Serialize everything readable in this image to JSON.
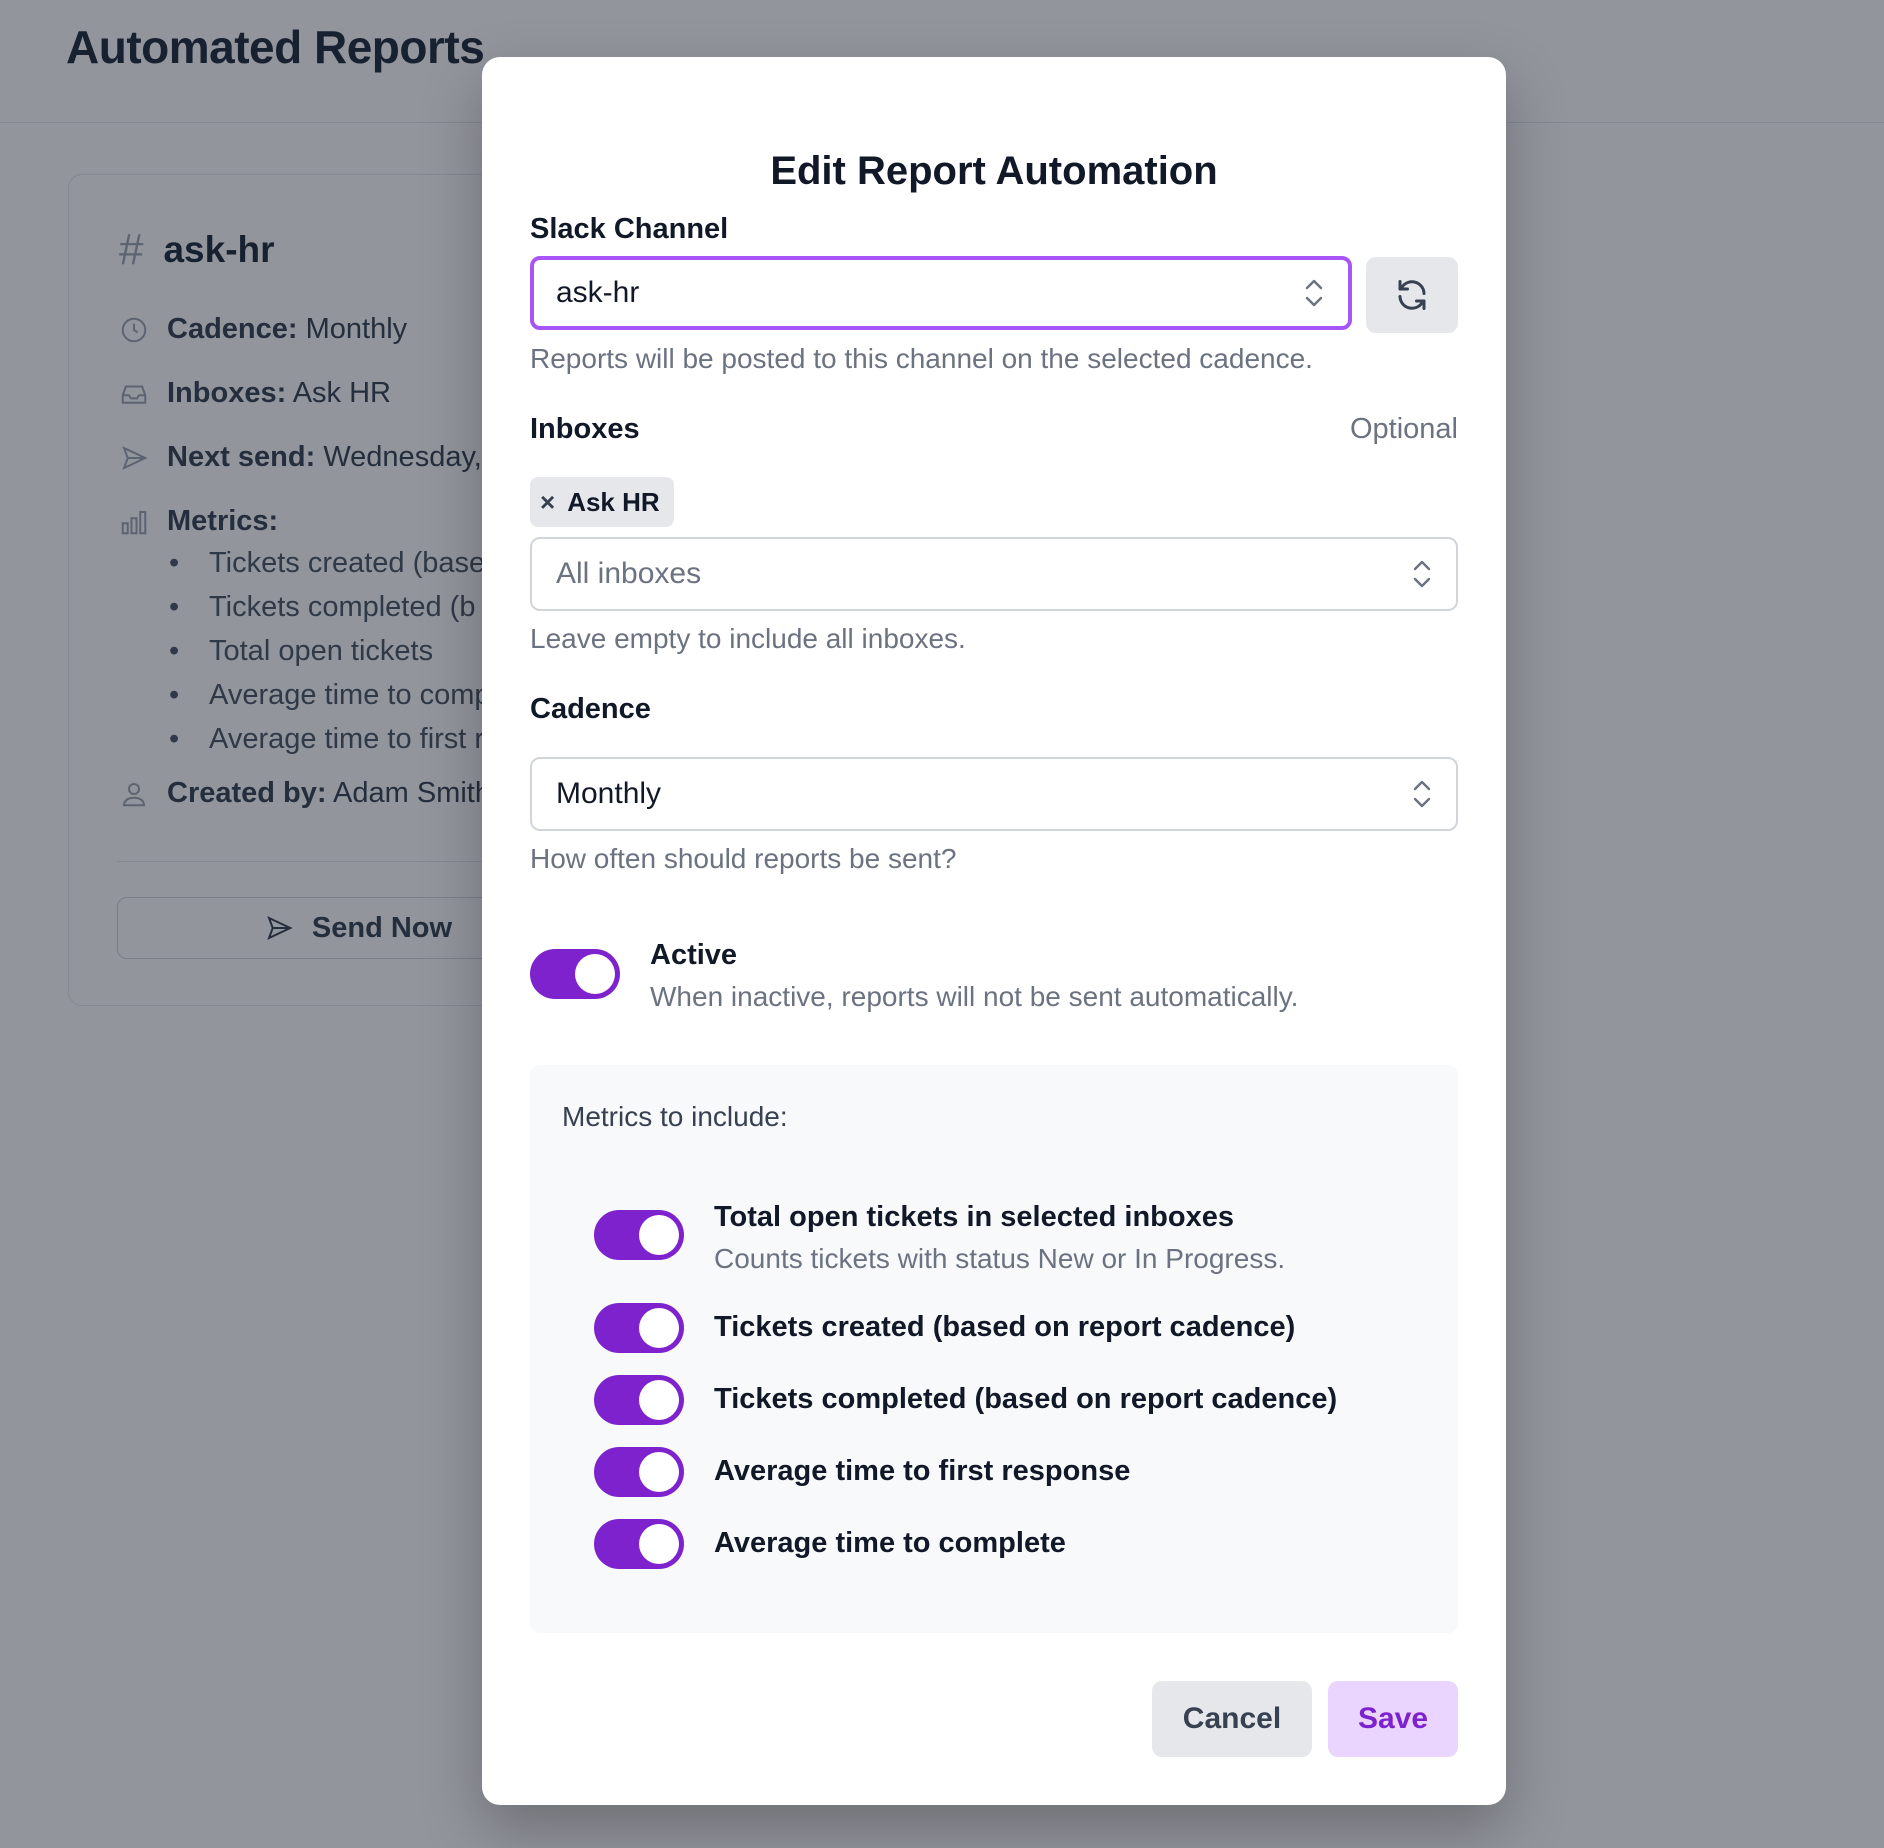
{
  "page": {
    "title": "Automated Reports",
    "card": {
      "channel": "ask-hr",
      "cadence_label": "Cadence:",
      "cadence_value": "Monthly",
      "inboxes_label": "Inboxes:",
      "inboxes_value": "Ask HR",
      "next_send_label": "Next send:",
      "next_send_value": "Wednesday, I",
      "metrics_label": "Metrics:",
      "metrics": [
        "Tickets created (base",
        "Tickets completed (b",
        "Total open tickets",
        "Average time to comp",
        "Average time to first r"
      ],
      "created_by_label": "Created by:",
      "created_by_value": "Adam Smith",
      "send_now_label": "Send Now"
    }
  },
  "modal": {
    "title": "Edit Report Automation",
    "slack_channel": {
      "label": "Slack Channel",
      "value": "ask-hr",
      "help": "Reports will be posted to this channel on the selected cadence."
    },
    "inboxes": {
      "label": "Inboxes",
      "optional": "Optional",
      "chips": [
        "Ask HR"
      ],
      "chip_remove": "×",
      "placeholder": "All inboxes",
      "help": "Leave empty to include all inboxes."
    },
    "cadence": {
      "label": "Cadence",
      "value": "Monthly",
      "help": "How often should reports be sent?"
    },
    "active": {
      "label": "Active",
      "description": "When inactive, reports will not be sent automatically.",
      "on": true
    },
    "metrics": {
      "title": "Metrics to include:",
      "items": [
        {
          "label": "Total open tickets in selected inboxes",
          "description": "Counts tickets with status New or In Progress.",
          "on": true
        },
        {
          "label": "Tickets created (based on report cadence)",
          "on": true
        },
        {
          "label": "Tickets completed (based on report cadence)",
          "on": true
        },
        {
          "label": "Average time to first response",
          "on": true
        },
        {
          "label": "Average time to complete",
          "on": true
        }
      ]
    },
    "buttons": {
      "cancel": "Cancel",
      "save": "Save"
    }
  },
  "colors": {
    "accent": "#7e22ce",
    "focus_ring": "#a855f7",
    "save_bg": "#e9d5ff"
  }
}
